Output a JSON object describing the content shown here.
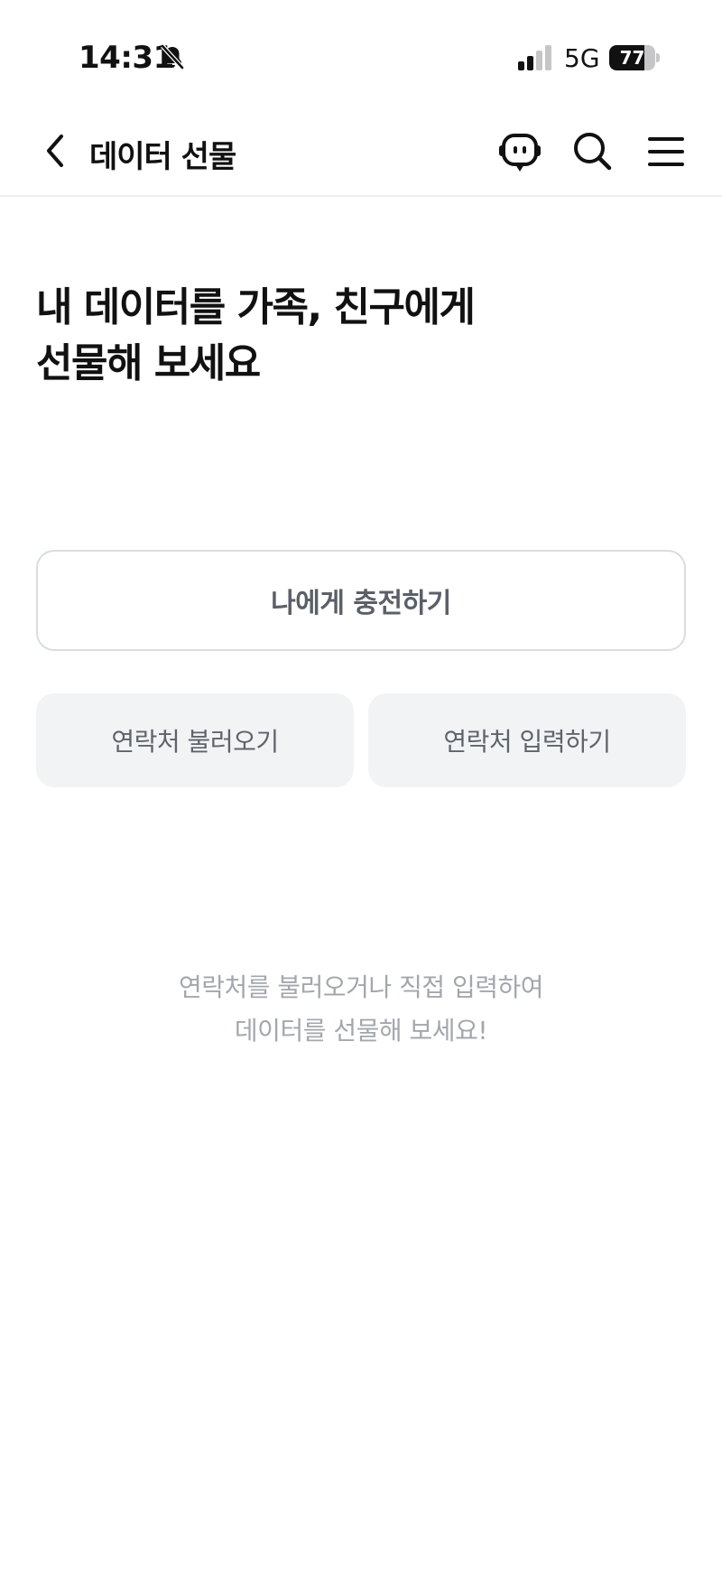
{
  "status_bar": {
    "time": "14:31",
    "network": "5G",
    "battery_percent": "77",
    "battery_level": 0.77,
    "icons": [
      "bell-slash-icon",
      "signal-icon",
      "battery-icon"
    ]
  },
  "nav": {
    "title": "데이터 선물",
    "icons": [
      "chevron-left-icon",
      "chatbot-icon",
      "search-icon",
      "menu-icon"
    ]
  },
  "headline": {
    "line1": "내 데이터를 가족, 친구에게",
    "line2": "선물해 보세요"
  },
  "actions": {
    "charge_self": "나에게 충전하기",
    "load_contacts": "연락처 불러오기",
    "enter_contact": "연락처 입력하기"
  },
  "empty_message": {
    "line1": "연락처를 불러오거나 직접 입력하여",
    "line2": "데이터를 선물해 보세요!"
  },
  "colors": {
    "text_primary": "#111111",
    "secondary_button_bg": "#f2f3f5",
    "border": "#d9dce0",
    "muted_text": "#a3a7ad"
  }
}
